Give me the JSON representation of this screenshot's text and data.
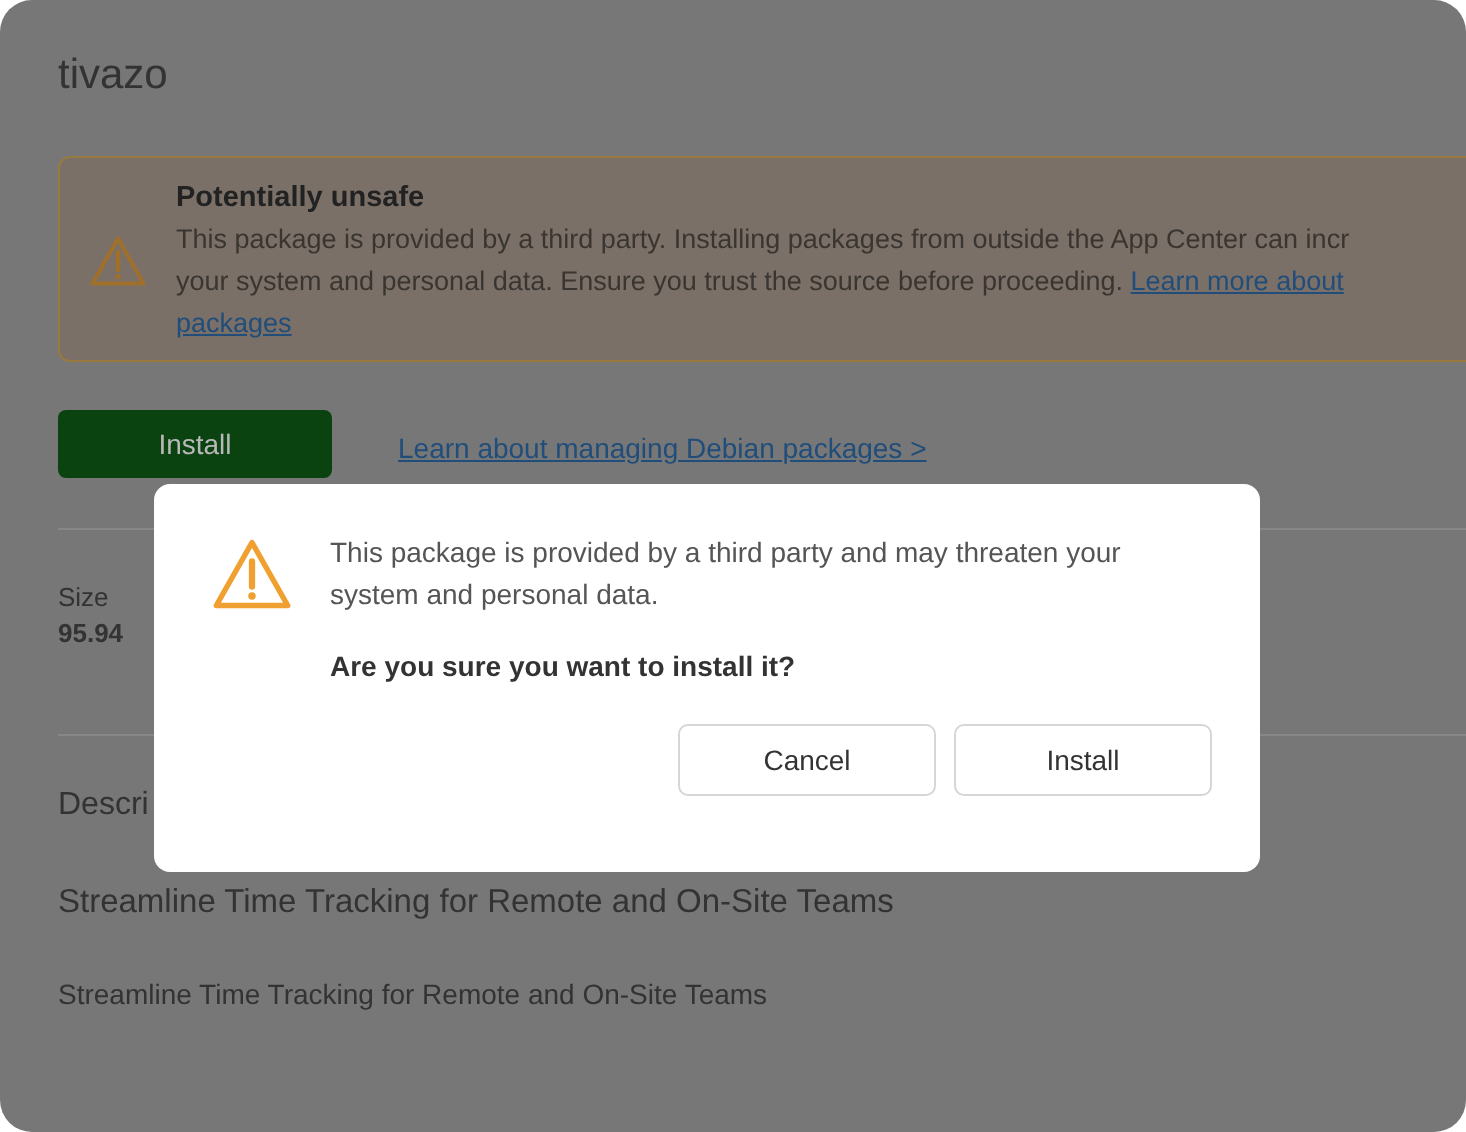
{
  "page": {
    "title": "tivazo",
    "warning": {
      "heading": "Potentially unsafe",
      "lines": [
        "This package is provided by a third party. Installing packages from outside the App Center can incr",
        "your system and personal data. Ensure you trust the source before proceeding. "
      ],
      "link_parts": [
        "Learn more about",
        "packages"
      ]
    },
    "install_button": "Install",
    "debian_link": "Learn about managing Debian packages >",
    "size": {
      "label": "Size",
      "value": "95.94"
    },
    "description_heading": "Descri",
    "summary": "Streamline Time Tracking for Remote and On-Site Teams",
    "description": "Streamline Time Tracking for Remote and On-Site Teams"
  },
  "dialog": {
    "message": "This package is provided by a third party and may threaten your system and personal data.",
    "question": "Are you sure you want to install it?",
    "buttons": [
      "Cancel",
      "Install"
    ]
  }
}
